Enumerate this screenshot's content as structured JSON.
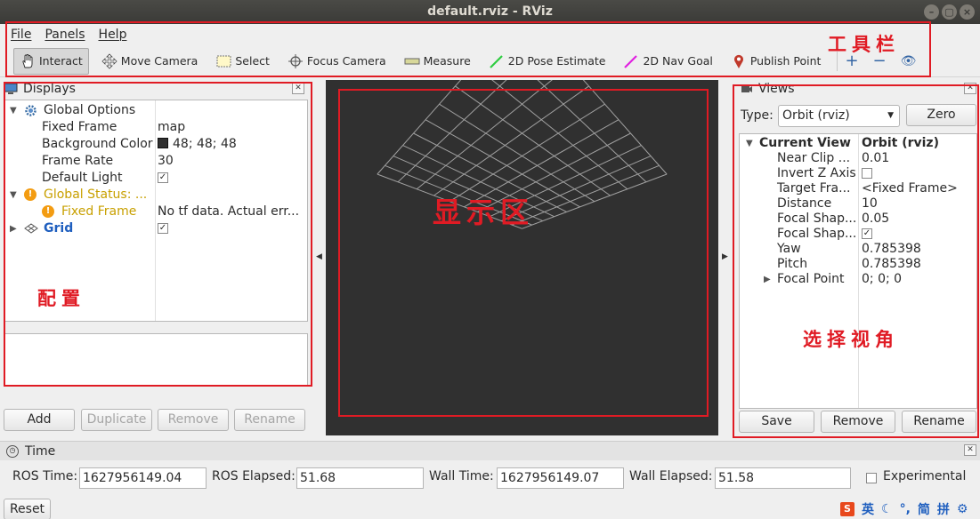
{
  "window": {
    "title": "default.rviz - RViz",
    "btn_min": "–",
    "btn_max": "▢",
    "btn_close": "×"
  },
  "menubar": [
    "File",
    "Panels",
    "Help"
  ],
  "toolbar": {
    "tools": [
      {
        "label": "Interact",
        "icon": "hand-icon",
        "active": true
      },
      {
        "label": "Move Camera",
        "icon": "move-camera-icon"
      },
      {
        "label": "Select",
        "icon": "select-box-icon"
      },
      {
        "label": "Focus Camera",
        "icon": "focus-crosshair-icon"
      },
      {
        "label": "Measure",
        "icon": "ruler-icon"
      },
      {
        "label": "2D Pose Estimate",
        "icon": "green-arrow-icon"
      },
      {
        "label": "2D Nav Goal",
        "icon": "magenta-arrow-icon"
      },
      {
        "label": "Publish Point",
        "icon": "map-pin-icon"
      }
    ],
    "add_icon": "+",
    "remove_icon": "−",
    "eye_icon": "👁"
  },
  "displays": {
    "title": "Displays",
    "rows": [
      {
        "label": "Global Options",
        "value": ""
      },
      {
        "label": "Fixed Frame",
        "value": "map"
      },
      {
        "label": "Background Color",
        "value": "48; 48; 48"
      },
      {
        "label": "Frame Rate",
        "value": "30"
      },
      {
        "label": "Default Light",
        "value": ""
      },
      {
        "label": "Global Status: ...",
        "value": ""
      },
      {
        "label": "Fixed Frame",
        "value": "No tf data.  Actual err..."
      },
      {
        "label": "Grid",
        "value": ""
      }
    ],
    "buttons": {
      "add": "Add",
      "duplicate": "Duplicate",
      "remove": "Remove",
      "rename": "Rename"
    },
    "bg_color": "#303030",
    "warn_mark": "!",
    "check_mark": "✓"
  },
  "views": {
    "title": "Views",
    "type_label": "Type:",
    "type_value": "Orbit (rviz)",
    "zero": "Zero",
    "rows": [
      {
        "label": "Current View",
        "value": "Orbit (rviz)"
      },
      {
        "label": "Near Clip ...",
        "value": "0.01"
      },
      {
        "label": "Invert Z Axis",
        "value": ""
      },
      {
        "label": "Target Fra...",
        "value": "<Fixed Frame>"
      },
      {
        "label": "Distance",
        "value": "10"
      },
      {
        "label": "Focal Shap...",
        "value": "0.05"
      },
      {
        "label": "Focal Shap...",
        "value": ""
      },
      {
        "label": "Yaw",
        "value": "0.785398"
      },
      {
        "label": "Pitch",
        "value": "0.785398"
      },
      {
        "label": "Focal Point",
        "value": "0; 0; 0"
      }
    ],
    "buttons": {
      "save": "Save",
      "remove": "Remove",
      "rename": "Rename"
    }
  },
  "time": {
    "title": "Time",
    "ros_time_label": "ROS Time:",
    "ros_time": "1627956149.04",
    "ros_elapsed_label": "ROS Elapsed:",
    "ros_elapsed": "51.68",
    "wall_time_label": "Wall Time:",
    "wall_time": "1627956149.07",
    "wall_elapsed_label": "Wall Elapsed:",
    "wall_elapsed": "51.58",
    "experimental": "Experimental",
    "reset": "Reset"
  },
  "annotations": {
    "toolbar": "工具栏",
    "display_area": "显示区",
    "config": "配置",
    "views": "选择视角"
  },
  "ime": {
    "english": "英",
    "moon": "☾",
    "comma": "°,",
    "simplified": "简",
    "pinyin": "拼",
    "settings": "⚙"
  }
}
